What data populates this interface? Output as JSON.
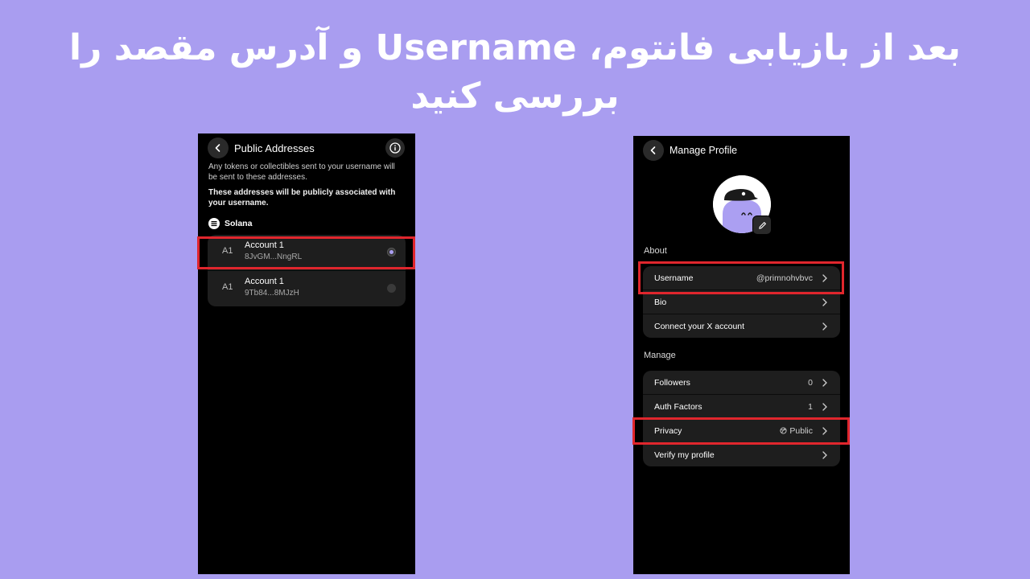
{
  "headline": "بعد از بازیابی فانتوم، Username و آدرس مقصد را بررسی کنید",
  "left_screen": {
    "title": "Public Addresses",
    "description": "Any tokens or collectibles sent to your username will be sent to these addresses.",
    "note": "These addresses will be publicly associated with your username.",
    "chain_label": "Solana",
    "accounts": [
      {
        "avatar": "A1",
        "name": "Account 1",
        "address": "8JvGM...NngRL",
        "selected": true
      },
      {
        "avatar": "A1",
        "name": "Account 1",
        "address": "9Tb84...8MJzH",
        "selected": false
      }
    ]
  },
  "right_screen": {
    "title": "Manage Profile",
    "about_label": "About",
    "about_rows": [
      {
        "label": "Username",
        "value": "@primnohvbvc"
      },
      {
        "label": "Bio",
        "value": ""
      },
      {
        "label": "Connect your X account",
        "value": ""
      }
    ],
    "manage_label": "Manage",
    "manage_rows": [
      {
        "label": "Followers",
        "value": "0"
      },
      {
        "label": "Auth Factors",
        "value": "1"
      },
      {
        "label": "Privacy",
        "value": "Public"
      },
      {
        "label": "Verify my profile",
        "value": ""
      }
    ]
  },
  "colors": {
    "background": "#a99df0",
    "highlight": "#e0262d",
    "accent": "#ab9ff2"
  },
  "icons": [
    "back-arrow-icon",
    "info-icon",
    "solana-icon",
    "edit-pencil-icon",
    "chevron-right-icon",
    "globe-icon"
  ]
}
